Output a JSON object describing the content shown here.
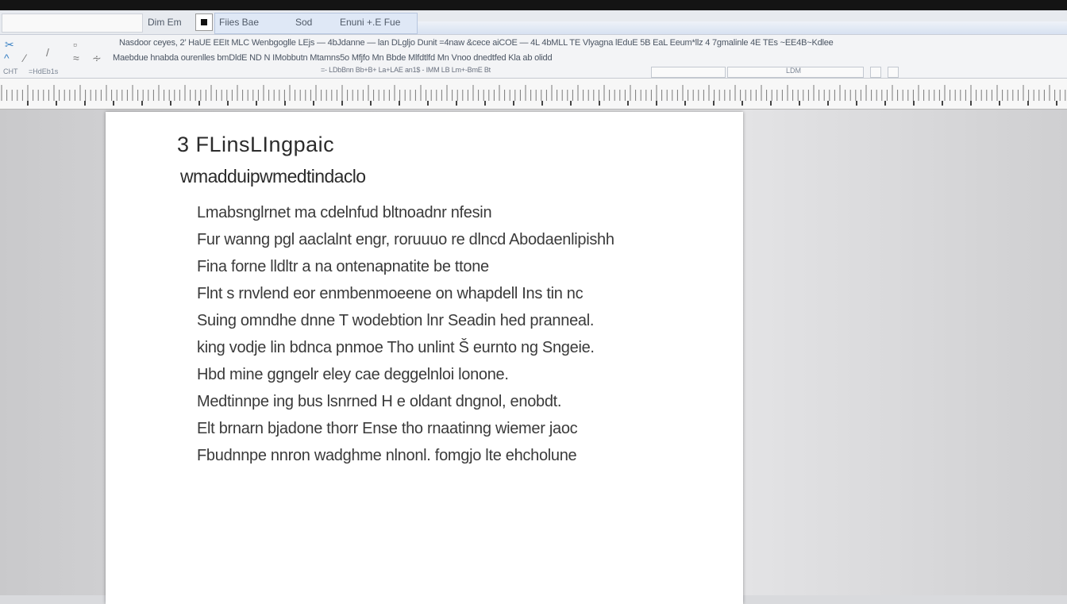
{
  "tabs": {
    "left": "Dim Em",
    "mid": "Fiies Bae",
    "mid2": "Sod",
    "active": "Enuni  +.E  Fue"
  },
  "ribbon": {
    "line1": "Nasdoor ceyes, 2’ HaUE  EEIt MLC  Wenbgoglle LEjs — 4bJdanne — lan DLgljo Dunit  =4naw &cece aiCOE  — 4L  4bMLL  TE Vlyagna  lEduE 5B  EaL  Eeum*llz  4 7gmalinle  4E  TEs ~EE4B~Kdlee",
    "line2": "Maebdue  hnabda ourenlles  bmDldE   ND N  IMobbutn  Mtamns5o  Mfjfo  Mn  Bbde  Mlfdtlfd  Mn Vnoo dnedtfed   Kla ab olidd",
    "line3": "=-  LDbBnn  Bb+B+  La+LAE  an1$  -   IMM  LB  Lm+-BmE  Bt",
    "left_labels": [
      "CHT",
      "=HdEb1s"
    ],
    "zoom_label": "LDM"
  },
  "document": {
    "heading1": "3 FLinsLIngpaic",
    "heading2": "wmadduipwmedtindaclo",
    "lines": [
      "Lmabsnglrnet ma  cdelnfud bltnoadnr  nfesin",
      "Fur wanng pgl aaclalnt engr,  roruuuo re dlncd  Abodaenlipishh",
      "Fina  forne lldltr a na ontenapnatite be ttone",
      "Flnt s rnvlend eor enmbenmoeene on  whapdell Ins tin  nc",
      "Suing omndhe dnne  T  wodebtion  lnr  Seadin hed  pranneal.",
      "king  vodje lin  bdnca pnmoe Tho unlint  Š eurnto ng Sngeie.",
      "Hbd  mine  ggngelr eley cae deggelnloi lonone.",
      "Medtinnpe  ing bus lsnrned  H e  oldant  dngnol, enobdt.",
      "Elt  brnarn  bjadone  thorr  Ense  tho   rnaatinng  wiemer  jaoc",
      "Fbudnnpe  nnron  wadghme  nlnonl.          fomgjo  lte  ehcholune"
    ]
  },
  "colors": {
    "topbar": "#141414",
    "ribbon": "#f3f4f6",
    "accent": "#3b82c4",
    "desk": "#dcdcde",
    "page": "#ffffff"
  }
}
